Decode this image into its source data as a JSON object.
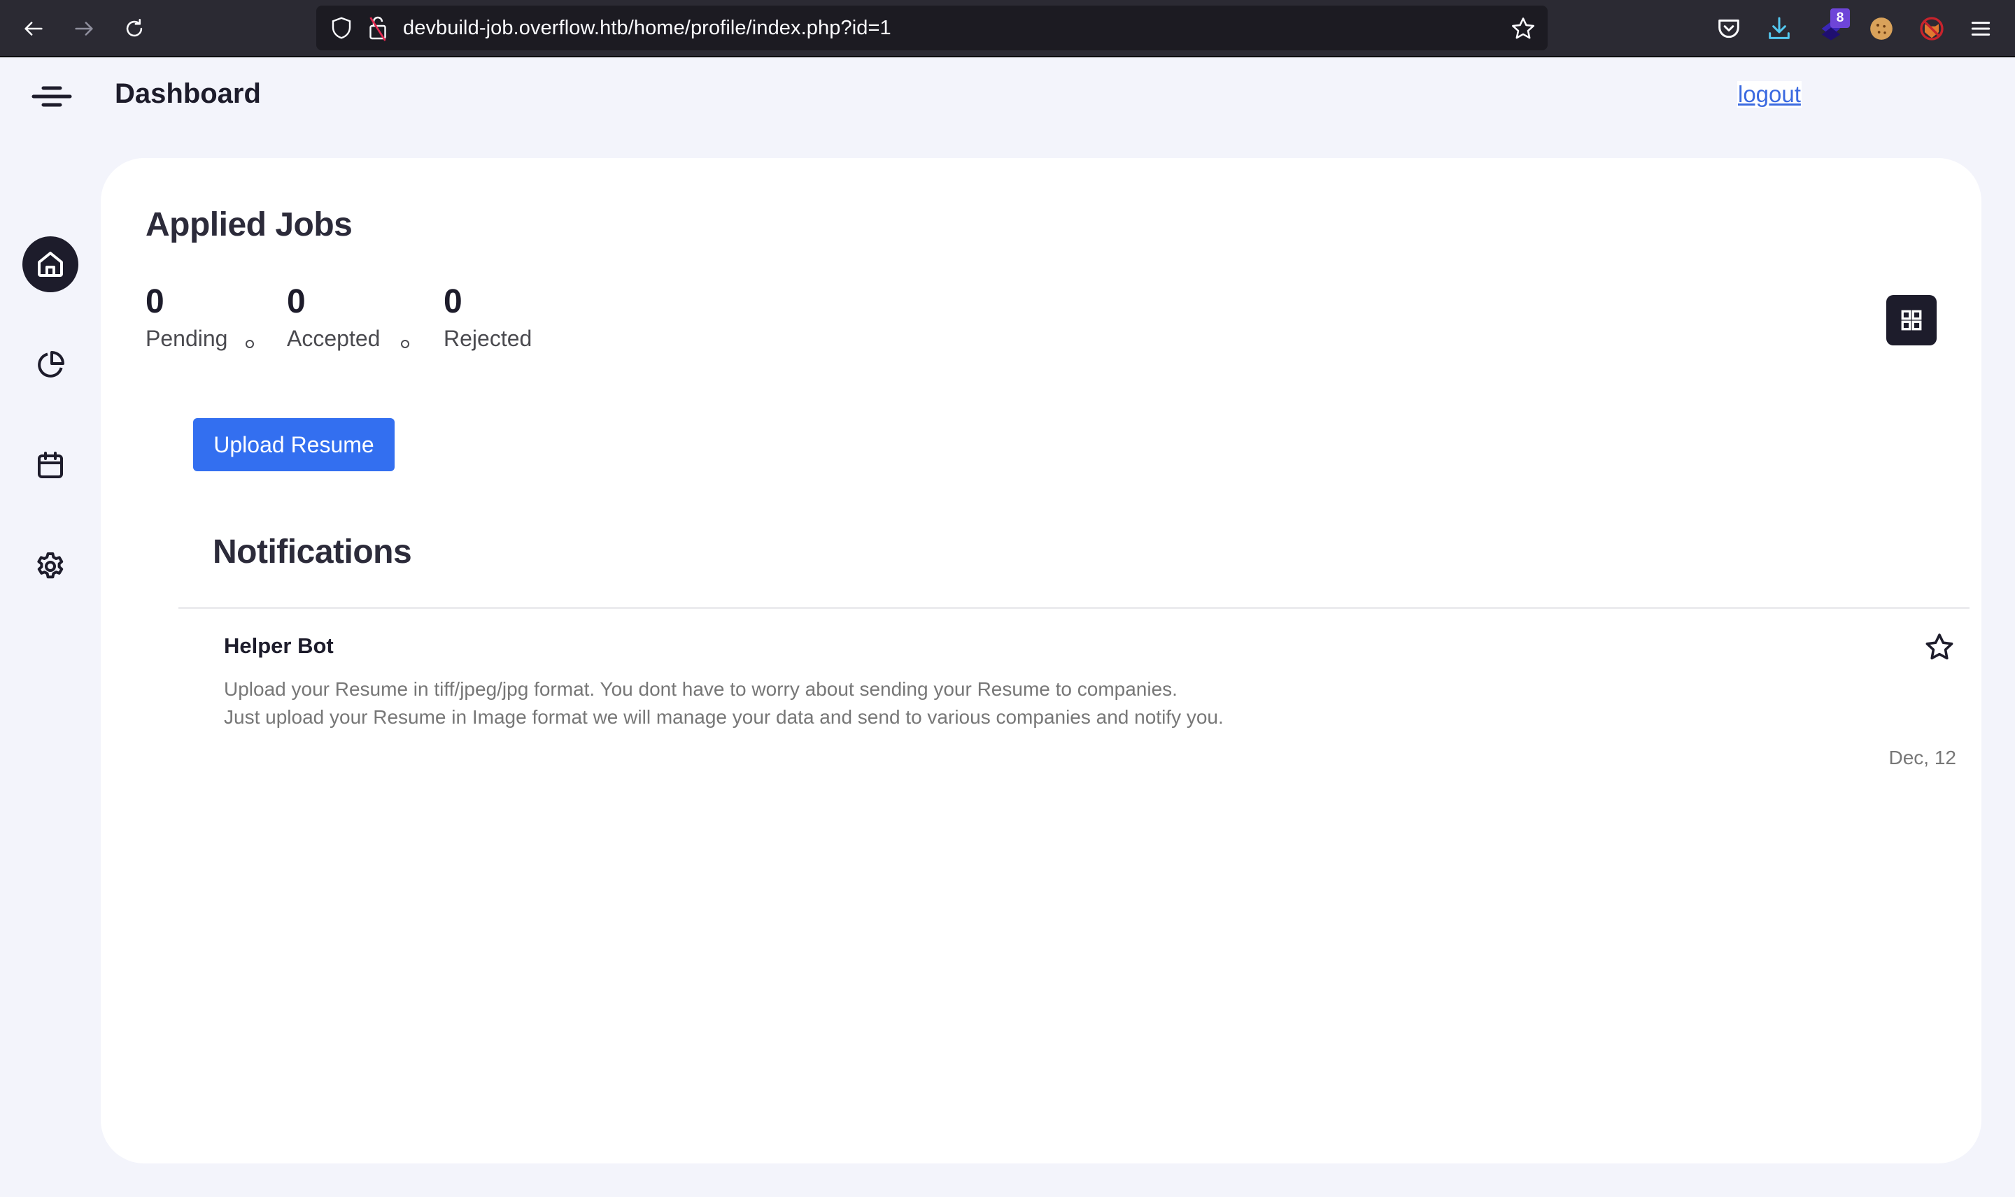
{
  "browser": {
    "url": "devbuild-job.overflow.htb/home/profile/index.php?id=1",
    "extension_badge": "8",
    "icons": [
      "back-icon",
      "forward-icon",
      "reload-icon",
      "shield-icon",
      "insecure-lock-icon",
      "bookmark-star-icon",
      "pocket-icon",
      "downloads-icon",
      "layers-extension-icon",
      "cookie-extension-icon",
      "blocked-fox-extension-icon",
      "menu-icon"
    ]
  },
  "header": {
    "title": "Dashboard",
    "logout_label": "logout"
  },
  "sidebar": {
    "items": [
      {
        "name": "home",
        "icon": "home-icon",
        "active": true
      },
      {
        "name": "analytics",
        "icon": "pie-chart-icon",
        "active": false
      },
      {
        "name": "calendar",
        "icon": "calendar-icon",
        "active": false
      },
      {
        "name": "settings",
        "icon": "gear-icon",
        "active": false
      }
    ]
  },
  "main": {
    "section_title": "Applied Jobs",
    "stats": [
      {
        "value": "0",
        "label": "Pending"
      },
      {
        "value": "0",
        "label": "Accepted"
      },
      {
        "value": "0",
        "label": "Rejected"
      }
    ],
    "upload_label": "Upload Resume",
    "notifications_title": "Notifications",
    "notifications": [
      {
        "sender": "Helper Bot",
        "lines": [
          "Upload your Resume in tiff/jpeg/jpg format. You dont have to worry about sending your Resume to companies.",
          "Just upload your Resume in Image format we will manage your data and send to various companies and notify you."
        ],
        "date": "Dec, 12"
      }
    ]
  },
  "colors": {
    "accent": "#336ff0",
    "dark": "#1d1c2b",
    "link": "#3b6ae0",
    "page_bg": "#f3f4fb",
    "muted_text": "#777777"
  }
}
